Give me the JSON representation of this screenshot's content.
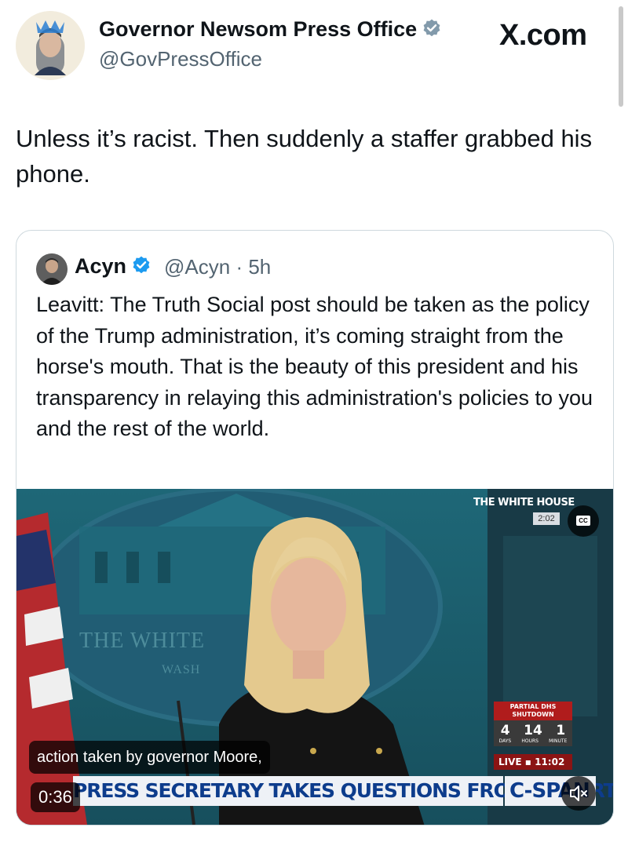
{
  "header": {
    "display_name": "Governor Newsom Press Office",
    "handle": "@GovPressOffice",
    "site_label": "X.com",
    "verified_color": "#536471"
  },
  "tweet": {
    "text": "Unless it’s racist. Then suddenly a staffer grabbed his phone."
  },
  "quote": {
    "name": "Acyn",
    "handle": "@Acyn",
    "separator": "·",
    "time": "5h",
    "text": "Leavitt: The Truth Social post should be taken as the policy of the Trump administration, it’s coming straight from the horse's mouth. That is the beauty of this president and his transparency in relaying this administration's policies to you and the rest of the world.",
    "verified_color": "#1d9bf0"
  },
  "video": {
    "caption": "action taken by governor Moore,",
    "chyron": "PRESS SECRETARY TAKES QUESTIONS FROM REPORTERS",
    "network": "C-SPAN",
    "timestamp": "0:36",
    "location_label": "THE WHITE HOUSE",
    "location_time": "2:02",
    "backdrop_text": "THE WHITE",
    "backdrop_text2": "WASH",
    "counter_title": "PARTIAL DHS SHUTDOWN",
    "counter_values": [
      "4",
      "14",
      "1"
    ],
    "counter_units": [
      "DAYS",
      "HOURS",
      "MINUTE"
    ],
    "live_label": "LIVE",
    "live_time": "11:02",
    "cc_label": "CC"
  }
}
